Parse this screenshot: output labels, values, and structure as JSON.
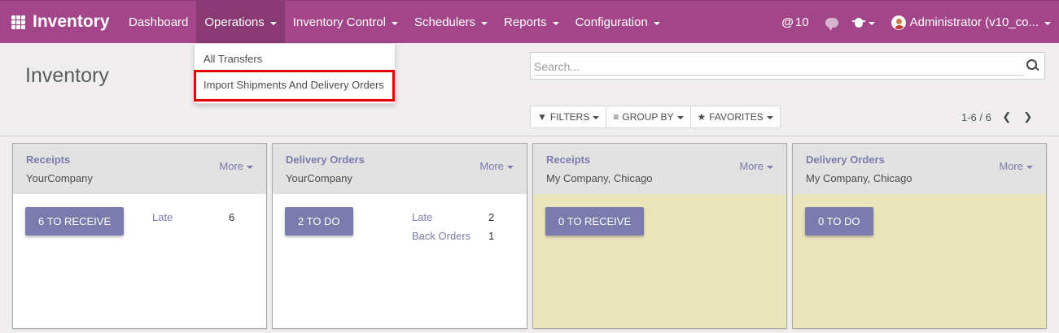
{
  "navbar": {
    "brand": "Inventory",
    "menu": [
      {
        "label": "Dashboard"
      },
      {
        "label": "Operations"
      },
      {
        "label": "Inventory Control"
      },
      {
        "label": "Schedulers"
      },
      {
        "label": "Reports"
      },
      {
        "label": "Configuration"
      }
    ],
    "mentions_count": "10",
    "user": "Administrator (v10_co..."
  },
  "operations_dropdown": {
    "items": [
      "All Transfers",
      "Import Shipments And Delivery Orders"
    ]
  },
  "control_panel": {
    "title": "Inventory",
    "search_placeholder": "Search...",
    "filters_label": "FILTERS",
    "group_by_label": "GROUP BY",
    "favorites_label": "FAVORITES",
    "pager": "1-6 / 6"
  },
  "cards": [
    {
      "title": "Receipts",
      "subtitle": "YourCompany",
      "more": "More",
      "button": "6 TO RECEIVE",
      "stats": [
        {
          "label": "Late",
          "value": "6"
        }
      ]
    },
    {
      "title": "Delivery Orders",
      "subtitle": "YourCompany",
      "more": "More",
      "button": "2 TO DO",
      "stats": [
        {
          "label": "Late",
          "value": "2"
        },
        {
          "label": "Back Orders",
          "value": "1"
        }
      ]
    },
    {
      "title": "Receipts",
      "subtitle": "My Company, Chicago",
      "more": "More",
      "button": "0 TO RECEIVE",
      "stats": []
    },
    {
      "title": "Delivery Orders",
      "subtitle": "My Company, Chicago",
      "more": "More",
      "button": "0 TO DO",
      "stats": []
    }
  ],
  "colors": {
    "navbar": "#a24689",
    "accent": "#7c7bad",
    "highlight_border": "#e60000",
    "warning_card": "#ebe5bc"
  }
}
